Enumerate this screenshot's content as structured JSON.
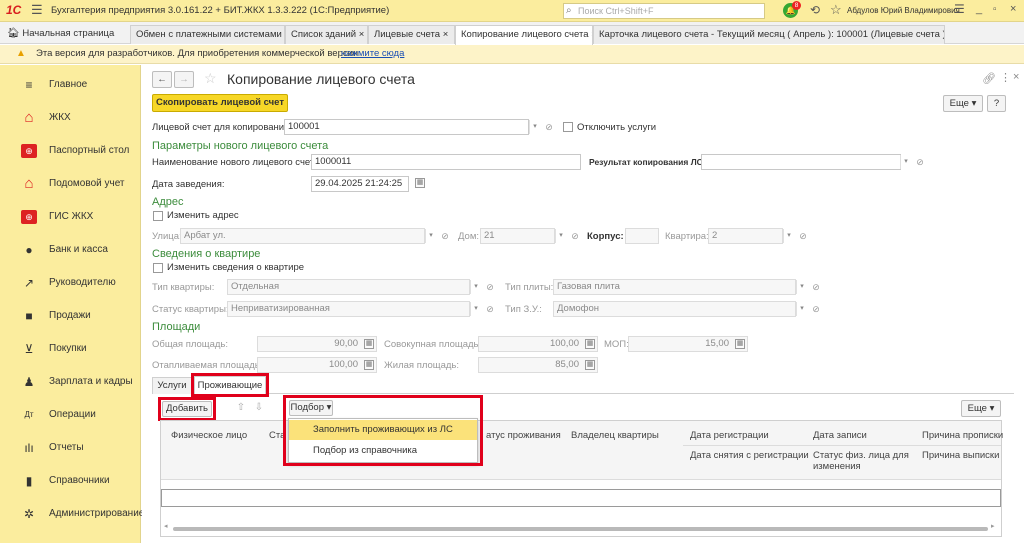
{
  "titlebar": {
    "app_title": "Бухгалтерия предприятия 3.0.161.22 + БИТ.ЖКХ 1.3.3.222 (1С:Предприятие)",
    "search_placeholder": "Поиск Ctrl+Shift+F",
    "user_name": "Абдулов Юрий Владимирович",
    "notification_count": "8"
  },
  "tabs": [
    {
      "label": "Начальная страница"
    },
    {
      "label": "Обмен с платежными системами"
    },
    {
      "label": "Список зданий"
    },
    {
      "label": "Лицевые счета"
    },
    {
      "label": "Копирование лицевого счета"
    },
    {
      "label": "Карточка лицевого счета - Текущий месяц ( Апрель ): 100001 (Лицевые счета )"
    }
  ],
  "warning": {
    "text": "Эта версия для разработчиков. Для приобретения коммерческой версии",
    "link": "нажмите сюда"
  },
  "sidebar": {
    "items": [
      {
        "label": "Главное",
        "icon": "menu-icon"
      },
      {
        "label": "ЖКХ",
        "icon": "house-icon"
      },
      {
        "label": "Паспортный стол",
        "icon": "passport-icon"
      },
      {
        "label": "Подомовой учет",
        "icon": "house-icon"
      },
      {
        "label": "ГИС ЖКХ",
        "icon": "gis-icon"
      },
      {
        "label": "Банк и касса",
        "icon": "bank-icon"
      },
      {
        "label": "Руководителю",
        "icon": "chart-line-icon"
      },
      {
        "label": "Продажи",
        "icon": "bag-icon"
      },
      {
        "label": "Покупки",
        "icon": "cart-icon"
      },
      {
        "label": "Зарплата и кадры",
        "icon": "person-icon"
      },
      {
        "label": "Операции",
        "icon": "operations-icon"
      },
      {
        "label": "Отчеты",
        "icon": "bar-chart-icon"
      },
      {
        "label": "Справочники",
        "icon": "book-icon"
      },
      {
        "label": "Администрирование",
        "icon": "gear-icon"
      }
    ]
  },
  "form": {
    "title": "Копирование лицевого счета",
    "copy_button": "Скопировать лицевой счет",
    "more_button": "Еще",
    "help_button": "?",
    "source_label": "Лицевой счет для копирования:",
    "source_value": "100001",
    "disable_services_label": "Отключить услуги",
    "params_header": "Параметры нового лицевого счета",
    "new_name_label": "Наименование нового лицевого счета:",
    "new_name_value": "1000011",
    "result_label": "Результат копирования ЛС:",
    "result_value": "",
    "date_label": "Дата заведения:",
    "date_value": "29.04.2025 21:24:25",
    "address_header": "Адрес",
    "change_address_label": "Изменить адрес",
    "street_label": "Улица:",
    "street_value": "Арбат ул.",
    "house_label": "Дом:",
    "house_value": "21",
    "corpus_label": "Корпус:",
    "corpus_value": "",
    "apt_label": "Квартира:",
    "apt_value": "2",
    "apt_info_header": "Сведения о квартире",
    "change_apt_label": "Изменить сведения о квартире",
    "apt_type_label": "Тип квартиры:",
    "apt_type_value": "Отдельная",
    "stove_label": "Тип плиты:",
    "stove_value": "Газовая плита",
    "apt_status_label": "Статус квартиры:",
    "apt_status_value": "Неприватизированная",
    "lock_label": "Тип З.У.:",
    "lock_value": "Домофон",
    "areas_header": "Площади",
    "total_area_label": "Общая площадь:",
    "total_area_value": "90,00",
    "agg_area_label": "Совокупная площадь:",
    "agg_area_value": "100,00",
    "mop_label": "МОП:",
    "mop_value": "15,00",
    "heated_label": "Отапливаемая площадь:",
    "heated_value": "100,00",
    "living_label": "Жилая площадь:",
    "living_value": "85,00"
  },
  "subtabs": [
    {
      "label": "Услуги"
    },
    {
      "label": "Проживающие"
    }
  ],
  "toolbar": {
    "add_button": "Добавить",
    "pick_button": "Подбор",
    "more_button": "Еще"
  },
  "pick_menu": {
    "items": [
      {
        "label": "Заполнить проживающих из ЛС"
      },
      {
        "label": "Подбор из справочника"
      }
    ]
  },
  "table": {
    "headers_row1": [
      "Физическое лицо",
      "Ста",
      "атус проживания",
      "Владелец квартиры",
      "Дата регистрации",
      "Дата записи",
      "Причина прописки"
    ],
    "headers_row2": [
      "Дата снятия с регистрации",
      "Статус физ. лица для изменения",
      "Причина выписки"
    ]
  }
}
